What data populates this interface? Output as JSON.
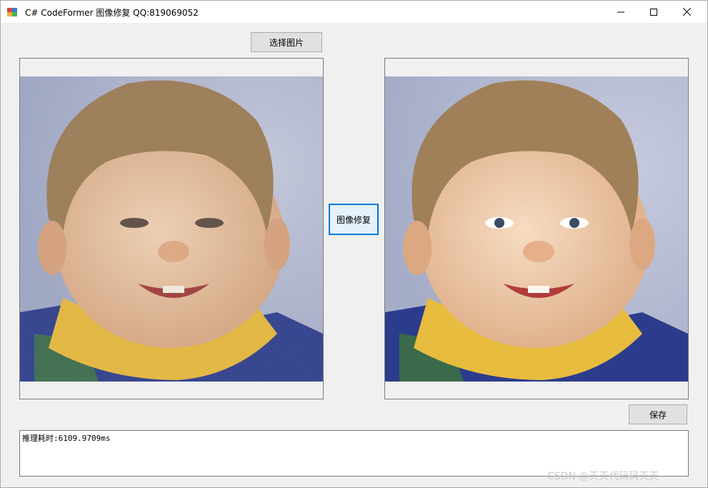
{
  "window": {
    "title": "C# CodeFormer 图像修复 QQ:819069052",
    "icon": "winforms-app-icon",
    "controls": {
      "minimize": "minimize-icon",
      "maximize": "maximize-icon",
      "close": "close-icon"
    }
  },
  "buttons": {
    "select_image": "选择图片",
    "restore": "图像修复",
    "save": "保存"
  },
  "images": {
    "input": "input-photo-child-smiling",
    "output": "restored-photo-child-smiling"
  },
  "log": {
    "text": "推理耗时:6109.9709ms"
  },
  "watermark": "CSDN @天天代码码天天",
  "colors": {
    "focus_border": "#0078d7",
    "backdrop": "#b7bfd8",
    "shirt_yellow": "#e6b83a",
    "jacket_blue": "#2c3c8c"
  }
}
